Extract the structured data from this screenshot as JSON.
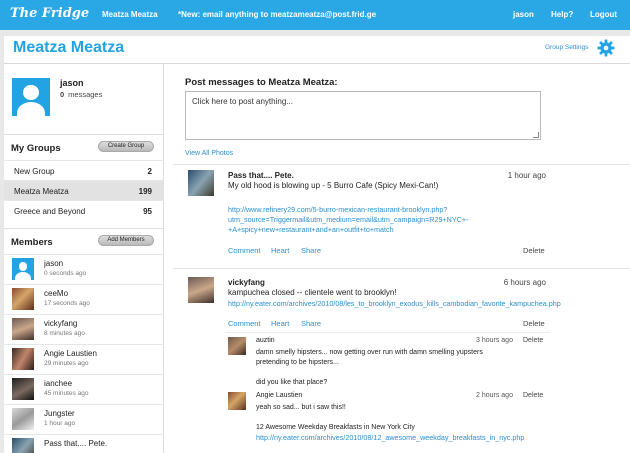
{
  "topbar": {
    "logo": "The Fridge",
    "group_link": "Meatza Meatza",
    "notice": "*New: email anything to meatzameatza@post.frid.ge",
    "user": "jason",
    "help": "Help?",
    "logout": "Logout"
  },
  "header": {
    "title": "Meatza Meatza",
    "settings_label": "Group Settings",
    "settings_icon": "gear-icon"
  },
  "profile": {
    "name": "jason",
    "message_count": "0",
    "messages_label": "messages"
  },
  "groups": {
    "title": "My Groups",
    "button": "Create Group",
    "items": [
      {
        "name": "New Group",
        "count": "2",
        "active": false
      },
      {
        "name": "Meatza Meatza",
        "count": "199",
        "active": true
      },
      {
        "name": "Greece and Beyond",
        "count": "95",
        "active": false
      }
    ]
  },
  "members": {
    "title": "Members",
    "button": "Add Members",
    "items": [
      {
        "name": "jason",
        "time": "0 seconds ago"
      },
      {
        "name": "ceeMo",
        "time": "17 seconds ago"
      },
      {
        "name": "vickyfang",
        "time": "8 minutes ago"
      },
      {
        "name": "Angie Laustien",
        "time": "29 minutes ago"
      },
      {
        "name": "ianchee",
        "time": "45 minutes ago"
      },
      {
        "name": "Jungster",
        "time": "1 hour ago"
      },
      {
        "name": "Pass that.... Pete.",
        "time": ""
      }
    ]
  },
  "composer": {
    "heading": "Post messages to Meatza Meatza:",
    "placeholder": "Click here to post anything...",
    "view_photos": "View All Photos"
  },
  "messages": [
    {
      "author": "Pass that.... Pete.",
      "time": "1 hour ago",
      "text": "My old hood is blowing up - 5 Burro Cafe (Spicy Mexi-Can!)",
      "link_lines": [
        "http://www.refinery29.com/5-burro-mexican-restaurant-brooklyn.php?",
        "utm_source=Triggermail&utm_medium=email&utm_campaign=R29+NYC+-",
        "+A+spicy+new+restaurant+and+an+outfit+to+match"
      ],
      "actions": [
        "Comment",
        "Heart",
        "Share"
      ],
      "delete": "Delete"
    },
    {
      "author": "vickyfang",
      "time": "6 hours ago",
      "text": "kampuchea closed -- clientele went to brooklyn!",
      "link_lines": [
        "http://ny.eater.com/archives/2010/08/les_to_brooklyn_exodus_kills_cambodian_favorite_kampuchea.php"
      ],
      "actions": [
        "Comment",
        "Heart",
        "Share"
      ],
      "delete": "Delete",
      "replies": [
        {
          "author": "auztin",
          "time": "3 hours ago",
          "lines": [
            "damn smelly hipsters... now getting over run with damn smelling yupsters",
            "pretending to be hipsters...",
            "",
            "did you like that place?"
          ],
          "delete": "Delete"
        },
        {
          "author": "Angie Laustien",
          "time": "2 hours ago",
          "lines": [
            "yeah so sad... but i saw this!!",
            "",
            "12 Awesome Weekday Breakfasts in New York City"
          ],
          "link": "http://ny.eater.com/archives/2010/08/12_awesome_weekday_breakfasts_in_nyc.php",
          "delete": "Delete"
        }
      ]
    }
  ],
  "colors": {
    "brand": "#2aa8e6",
    "link": "#2a8fd0",
    "active_row": "#e2e2e2"
  }
}
